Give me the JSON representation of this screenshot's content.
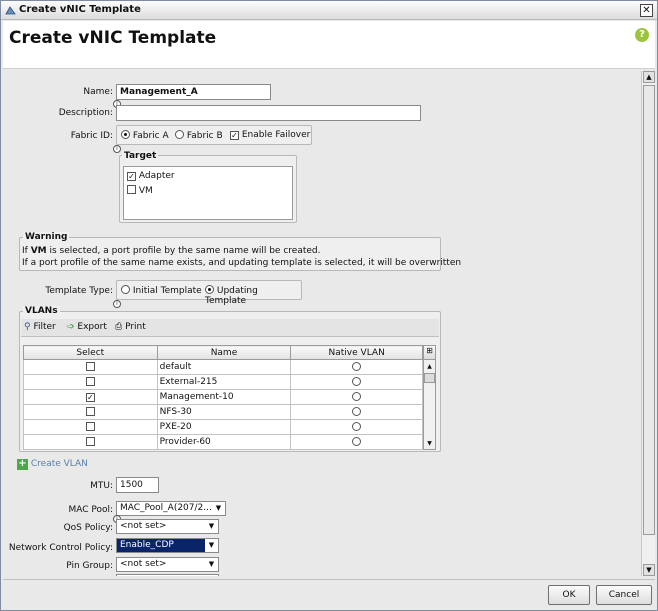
{
  "window": {
    "title": "Create vNIC Template",
    "close_glyph": "✕"
  },
  "header": {
    "title": "Create vNIC Template",
    "help_glyph": "?"
  },
  "form": {
    "name_label": "Name:",
    "name_value": "Management_A",
    "description_label": "Description:",
    "description_value": "",
    "fabric_label": "Fabric ID:",
    "fabric_a": "Fabric A",
    "fabric_b": "Fabric B",
    "fabric_selected": "Fabric A",
    "enable_failover": "Enable Failover",
    "enable_failover_checked": true,
    "target_title": "Target",
    "target_adapter": "Adapter",
    "target_adapter_checked": true,
    "target_vm": "VM",
    "target_vm_checked": false,
    "warning_title": "Warning",
    "warning_line1_prefix": "If ",
    "warning_line1_bold": "VM",
    "warning_line1_suffix": " is selected, a port profile by the same name will be created.",
    "warning_line2": "If a port profile of the same name exists, and updating template is selected, it will be overwritten",
    "template_type_label": "Template Type:",
    "initial_template": "Initial Template",
    "updating_template": "Updating Template",
    "template_type_selected": "Updating Template"
  },
  "vlans": {
    "title": "VLANs",
    "toolbar": {
      "filter": "Filter",
      "export": "Export",
      "print": "Print"
    },
    "columns": [
      "Select",
      "Name",
      "Native VLAN"
    ],
    "rows": [
      {
        "name": "default",
        "selected": false,
        "native": false
      },
      {
        "name": "External-215",
        "selected": false,
        "native": false
      },
      {
        "name": "Management-10",
        "selected": true,
        "native": false
      },
      {
        "name": "NFS-30",
        "selected": false,
        "native": false
      },
      {
        "name": "PXE-20",
        "selected": false,
        "native": false
      },
      {
        "name": "Provider-60",
        "selected": false,
        "native": false
      }
    ],
    "create_vlan": "Create VLAN"
  },
  "settings": {
    "mtu_label": "MTU:",
    "mtu_value": "1500",
    "mac_pool_label": "MAC Pool:",
    "mac_pool_value": "MAC_Pool_A(207/2...",
    "qos_label": "QoS Policy:",
    "qos_value": "<not set>",
    "ncp_label": "Network Control Policy:",
    "ncp_value": "Enable_CDP",
    "pin_group_label": "Pin Group:",
    "pin_group_value": "<not set>"
  },
  "footer": {
    "ok": "OK",
    "cancel": "Cancel"
  },
  "colors": {
    "highlight": "#0a246a",
    "help_green": "#9bc53d",
    "create_green": "#4ca64c"
  }
}
